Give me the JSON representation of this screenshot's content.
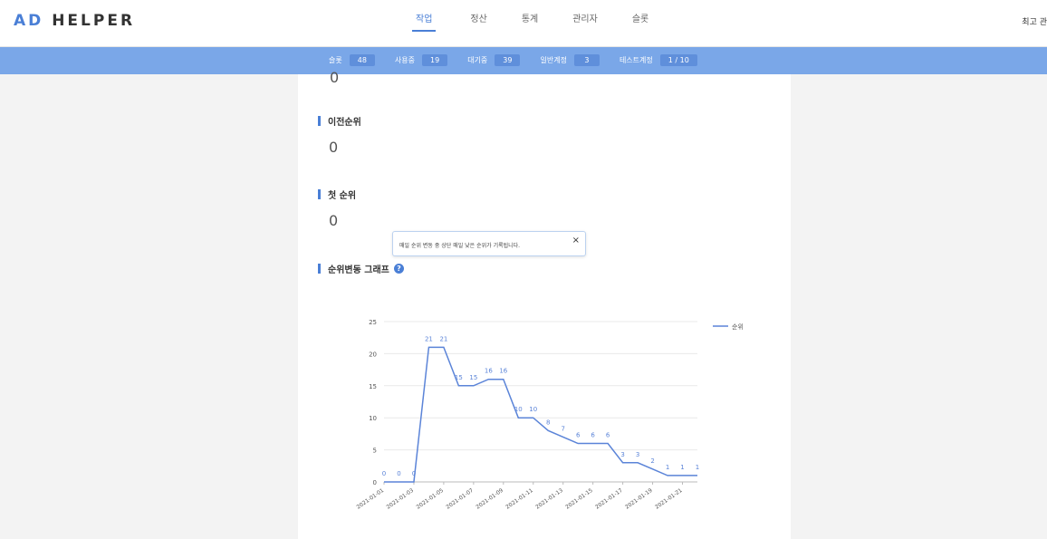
{
  "header": {
    "logo_accent": "AD",
    "logo_text": "HELPER",
    "nav": [
      "작업",
      "정산",
      "통계",
      "관리자",
      "슬롯"
    ],
    "active_nav": 0,
    "user_link": "최고 관"
  },
  "status": [
    {
      "label": "슬롯",
      "value": "48"
    },
    {
      "label": "사용중",
      "value": "19"
    },
    {
      "label": "대기중",
      "value": "39"
    },
    {
      "label": "일반계정",
      "value": "3"
    },
    {
      "label": "테스트계정",
      "value": "1 / 10"
    }
  ],
  "sections": {
    "top_cut_value": "0",
    "prev_rank": {
      "title": "이전순위",
      "value": "0"
    },
    "first_rank": {
      "title": "첫 순위",
      "value": "0"
    },
    "rank_graph": {
      "title": "순위변동 그래프",
      "help_icon": "question-circle-icon"
    }
  },
  "tooltip": {
    "text": "매일 순위 변동 중 상단 매일 낮은 순위가 기록됩니다.",
    "close": "×"
  },
  "colors": {
    "accent": "#4a7fd6",
    "status_bar": "#7aa7e8",
    "line": "#5b84d8"
  },
  "chart_data": {
    "type": "line",
    "x": [
      "2021-01-01",
      "2021-01-02",
      "2021-01-03",
      "2021-01-04",
      "2021-01-05",
      "2021-01-06",
      "2021-01-07",
      "2021-01-08",
      "2021-01-09",
      "2021-01-10",
      "2021-01-11",
      "2021-01-12",
      "2021-01-13",
      "2021-01-14",
      "2021-01-15",
      "2021-01-16",
      "2021-01-17",
      "2021-01-18",
      "2021-01-19",
      "2021-01-20",
      "2021-01-21",
      "2021-01-22"
    ],
    "x_tick_labels": [
      "2021-01-01",
      "2021-01-03",
      "2021-01-05",
      "2021-01-07",
      "2021-01-09",
      "2021-01-11",
      "2021-01-13",
      "2021-01-15",
      "2021-01-17",
      "2021-01-19",
      "2021-01-21"
    ],
    "series": [
      {
        "name": "순위",
        "values": [
          0,
          0,
          0,
          21,
          21,
          15,
          15,
          16,
          16,
          10,
          10,
          8,
          7,
          6,
          6,
          6,
          3,
          3,
          2,
          1,
          1,
          1
        ]
      }
    ],
    "ylim": [
      0,
      25
    ],
    "yticks": [
      0,
      5,
      10,
      15,
      20,
      25
    ],
    "grid": true,
    "legend": "top-right",
    "data_labels": true
  }
}
